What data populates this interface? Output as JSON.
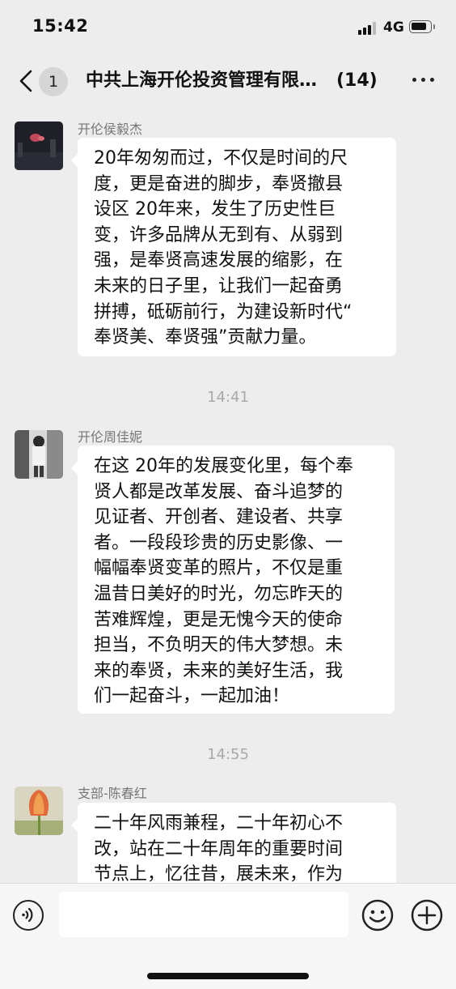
{
  "status_bar": {
    "time": "15:42",
    "network": "4G"
  },
  "nav": {
    "unread_count": "1",
    "title": "中共上海开伦投资管理有限公司",
    "member_count": "(14)"
  },
  "messages": [
    {
      "sender": "开伦侯毅杰",
      "lines": [
        "20年匆匆而过，不仅是时间的尺",
        "度，更是奋进的脚步，奉贤撤县",
        "设区 20年来，发生了历史性巨",
        "变，许多品牌从无到有、从弱到",
        "强，是奉贤高速发展的缩影，在",
        "未来的日子里，让我们一起奋勇",
        "拼搏，砥砺前行，为建设新时代“",
        "奉贤美、奉贤强”贡献力量。"
      ]
    },
    {
      "timestamp": "14:41"
    },
    {
      "sender": "开伦周佳妮",
      "lines": [
        "在这 20年的发展变化里，每个奉",
        "贤人都是改革发展、奋斗追梦的",
        "见证者、开创者、建设者、共享",
        "者。一段段珍贵的历史影像、一",
        "幅幅奉贤变革的照片，不仅是重",
        "温昔日美好的时光，勿忘昨天的",
        "苦难辉煌，更是无愧今天的使命",
        "担当，不负明天的伟大梦想。未",
        "来的奉贤，未来的美好生活，我",
        "们一起奋斗，一起加油！"
      ]
    },
    {
      "timestamp": "14:55"
    },
    {
      "sender": "支部-陈春红",
      "lines": [
        "二十年风雨兼程，二十年初心不",
        "改，站在二十年周年的重要时间",
        "节点上，忆往昔，展未来，作为"
      ]
    }
  ],
  "input": {
    "value": "",
    "placeholder": ""
  },
  "colors": {
    "background": "#ededed",
    "bubble": "#ffffff",
    "meta_text": "#a9a9a9"
  },
  "icons": {
    "back": "chevron-left-icon",
    "more": "more-dots-icon",
    "voice": "voice-icon",
    "emoji": "emoji-icon",
    "plus": "plus-icon"
  }
}
